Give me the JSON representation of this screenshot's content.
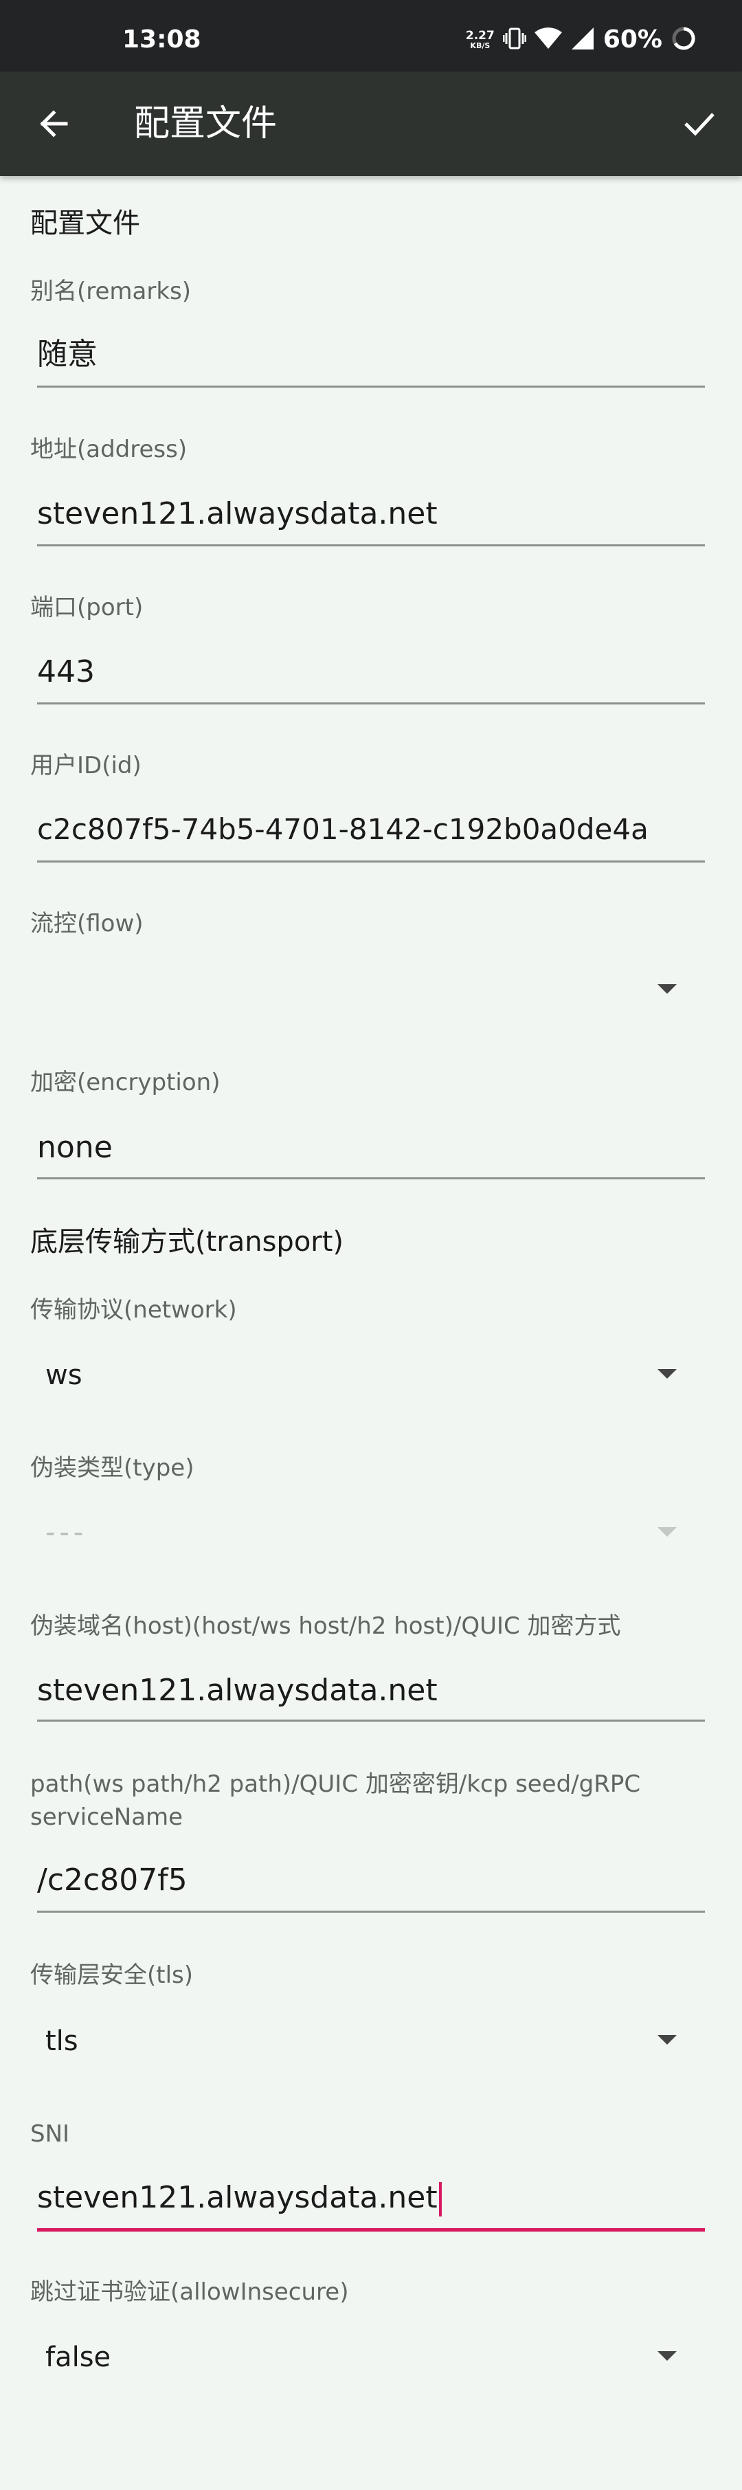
{
  "status_bar": {
    "time": "13:08",
    "net_speed": "2.27",
    "net_unit": "KB/S",
    "battery": "60%",
    "icons": [
      "vibrate-icon",
      "wifi-icon",
      "signal-icon",
      "battery-ring-icon"
    ]
  },
  "app_bar": {
    "title": "配置文件",
    "back_icon": "arrow-back-icon",
    "confirm_icon": "check-icon"
  },
  "section_profile": "配置文件",
  "remarks": {
    "label": "别名(remarks)",
    "value": "随意"
  },
  "address": {
    "label": "地址(address)",
    "value": "steven121.alwaysdata.net"
  },
  "port": {
    "label": "端口(port)",
    "value": "443"
  },
  "id": {
    "label": "用户ID(id)",
    "value": "c2c807f5-74b5-4701-8142-c192b0a0de4a"
  },
  "flow": {
    "label": "流控(flow)",
    "value": ""
  },
  "encryption": {
    "label": "加密(encryption)",
    "value": "none"
  },
  "section_transport": "底层传输方式(transport)",
  "network": {
    "label": "传输协议(network)",
    "value": "ws"
  },
  "type": {
    "label": "伪装类型(type)",
    "value": "---"
  },
  "host": {
    "label": "伪装域名(host)(host/ws host/h2 host)/QUIC 加密方式",
    "value": "steven121.alwaysdata.net"
  },
  "path": {
    "label": "path(ws path/h2 path)/QUIC 加密密钥/kcp seed/gRPC serviceName",
    "value": "/c2c807f5"
  },
  "tls": {
    "label": "传输层安全(tls)",
    "value": "tls"
  },
  "sni": {
    "label": "SNI",
    "value": "steven121.alwaysdata.net"
  },
  "allow_insecure": {
    "label": "跳过证书验证(allowInsecure)",
    "value": "false"
  },
  "colors": {
    "status_bar": "#232426",
    "app_bar": "#2e332f",
    "background": "#f1f6f2",
    "accent": "#d81b60"
  }
}
